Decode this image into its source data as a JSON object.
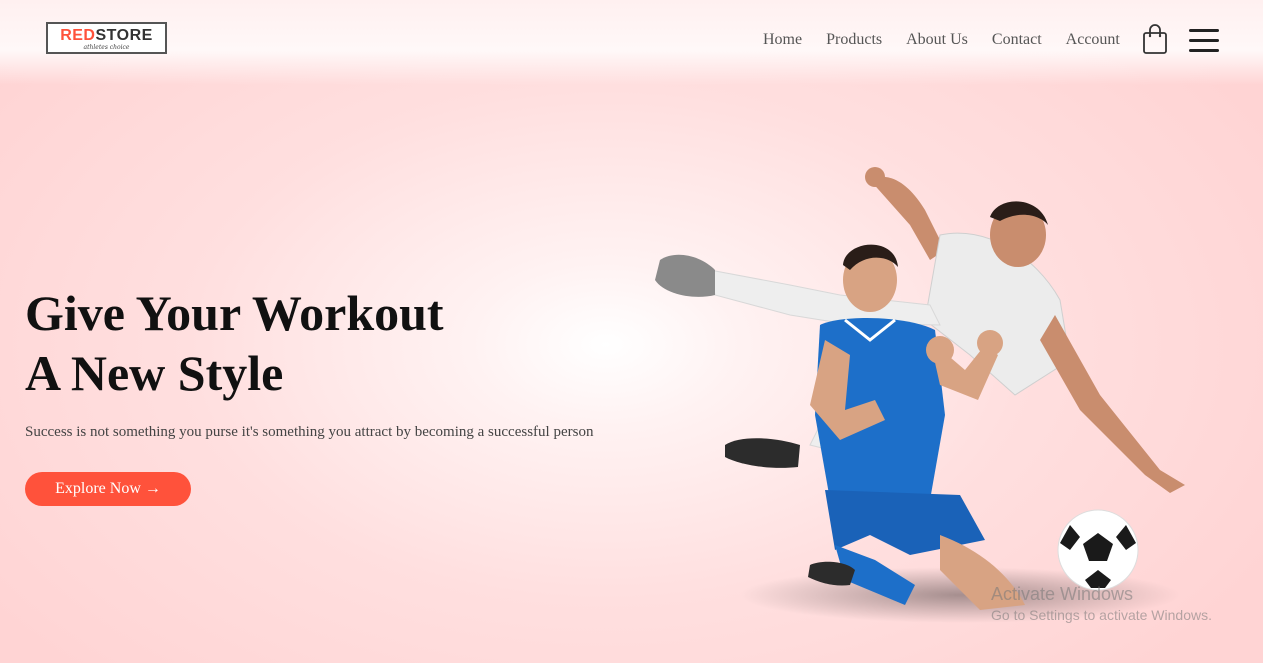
{
  "nav": {
    "logo": {
      "red_part": "RED",
      "rest_part": "STORE",
      "tagline": "athletes choice"
    },
    "menu": [
      "Home",
      "Products",
      "About Us",
      "Contact",
      "Account"
    ],
    "cart_icon": "shopping-bag-icon",
    "menu_icon": "hamburger-icon"
  },
  "hero": {
    "headline_line1": "Give Your Workout",
    "headline_line2": "A New Style",
    "subtitle": "Success is not something you purse it's something you attract by becoming a successful person",
    "button_label": "Explore Now →",
    "image": "football-players-image"
  },
  "watermark": {
    "title": "Activate Windows",
    "subtitle": "Go to Settings to activate Windows."
  },
  "colors": {
    "accent": "#ff523b",
    "background": "#ffdada",
    "text": "#111111"
  }
}
